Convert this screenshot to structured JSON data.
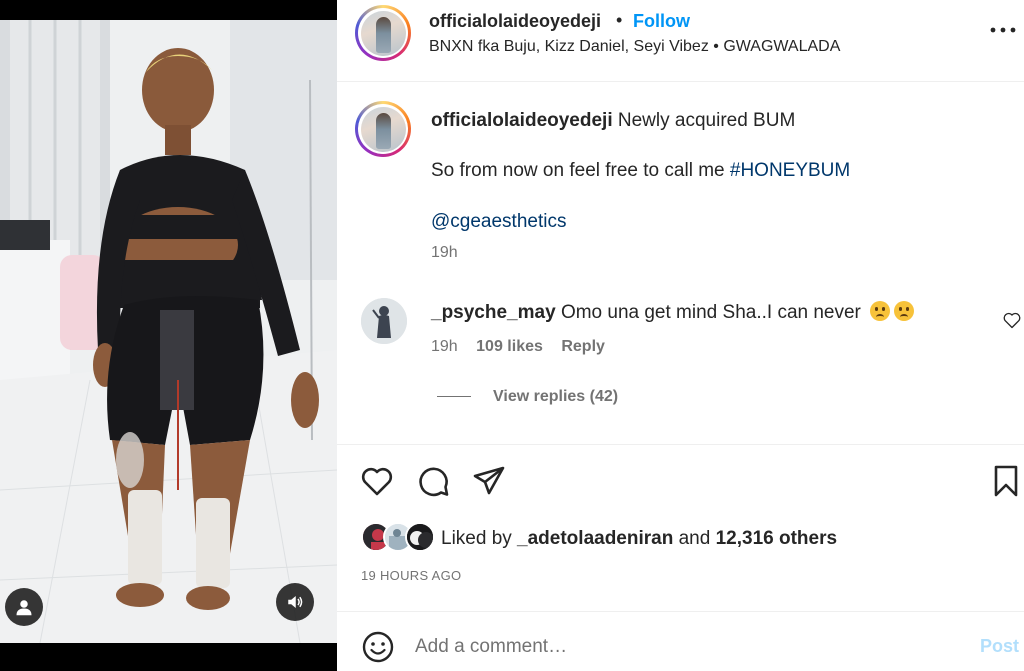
{
  "colors": {
    "accent": "#0095f6",
    "link": "#00376b",
    "muted": "#737373",
    "text": "#262626",
    "post_disabled": "#b2dffc"
  },
  "media": {
    "user_icon": "user-icon",
    "sound_icon": "sound-on-icon"
  },
  "header": {
    "username": "officialolaideoyedeji",
    "separator": "•",
    "follow_label": "Follow",
    "subtitle": "BNXN fka Buju, Kizz Daniel, Seyi Vibez • GWAGWALADA",
    "more_icon": "more-options-icon"
  },
  "caption": {
    "username": "officialolaideoyedeji",
    "text": "Newly acquired BUM",
    "line2_prefix": "So from now on feel free to call me ",
    "hashtag": "#HONEYBUM",
    "mention": "@cgeaesthetics",
    "time": "19h"
  },
  "comment": {
    "username": "_psyche_may",
    "text": "Omo una get mind Sha..I can never",
    "time": "19h",
    "likes": "109 likes",
    "reply_label": "Reply",
    "view_replies": "View replies (42)"
  },
  "actions": {
    "like_icon": "heart-icon",
    "comment_icon": "comment-icon",
    "share_icon": "share-icon",
    "save_icon": "bookmark-icon"
  },
  "likes": {
    "prefix": "Liked by ",
    "user": "_adetolaadeniran",
    "middle": " and ",
    "others": "12,316 others"
  },
  "post_time": "19 HOURS AGO",
  "comment_box": {
    "placeholder": "Add a comment…",
    "post_label": "Post",
    "emoji_icon": "emoji-icon"
  }
}
